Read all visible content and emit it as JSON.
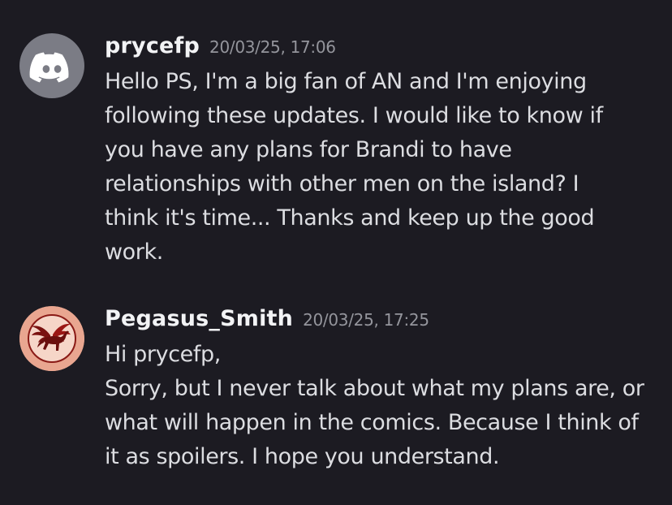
{
  "messages": [
    {
      "username": "prycefp",
      "timestamp": "20/03/25, 17:06",
      "avatar_icon": "discord-logo-icon",
      "avatar_color": "#7b7c85",
      "lines": [
        "Hello PS, I'm a big fan of AN and I'm enjoying",
        "following these updates. I would like to know if",
        "you have any plans for Brandi to have",
        "relationships with other men on the island? I",
        "think it's time... Thanks and keep up the good",
        "work."
      ]
    },
    {
      "username": "Pegasus_Smith",
      "timestamp": "20/03/25, 17:25",
      "avatar_icon": "pegasus-logo-icon",
      "avatar_color": "#e7a38e",
      "lines": [
        "Hi prycefp,",
        "Sorry, but I never talk about what my plans are, or",
        "what will happen in the comics. Because I think of",
        "it as spoilers. I hope you understand."
      ]
    }
  ],
  "colors": {
    "background": "#1c1b22",
    "username": "#f2f3f5",
    "timestamp": "#94959c",
    "message_text": "#dcdde1"
  }
}
